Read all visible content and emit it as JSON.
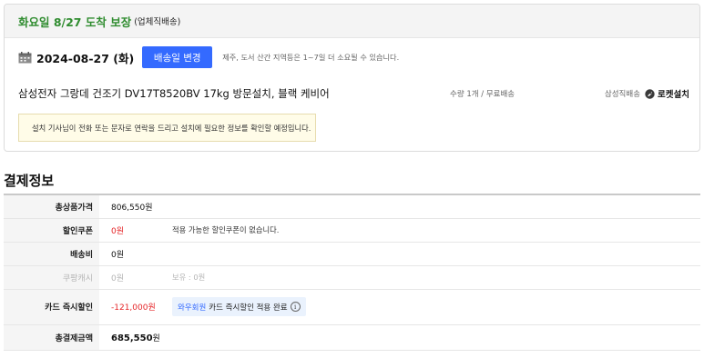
{
  "delivery": {
    "arrival_text": "화요일 8/27 도착 보장",
    "arrival_sub": "(업체직배송)",
    "date_text": "2024-08-27 (화)",
    "change_button": "배송일 변경",
    "date_note": "제주, 도서 산간 지역등은 1~7일 더 소요될 수 있습니다.",
    "product_name": "삼성전자 그랑데 건조기 DV17T8520BV 17kg 방문설치, 블랙 케비어",
    "quantity_text": "수량 1개 / 무료배송",
    "seller_label": "삼성직배송",
    "rocket_label": "로켓설치",
    "install_note": "설치 기사님이 전화 또는 문자로 연락을 드리고 설치에 필요한 정보를 확인할 예정입니다.",
    "accent_color": "#2f8c2f",
    "button_color": "#346aff"
  },
  "payment": {
    "title": "결제정보",
    "rows": [
      {
        "label": "총상품가격",
        "value": "806,550원",
        "info": ""
      },
      {
        "label": "할인쿠폰",
        "value": "0원",
        "info": "적용 가능한 할인쿠폰이 없습니다."
      },
      {
        "label": "배송비",
        "value": "0원",
        "info": ""
      },
      {
        "label": "쿠팡캐시",
        "value": "0원",
        "info": "보유 : 0원"
      },
      {
        "label": "카드 즉시할인",
        "value": "-121,000원",
        "info_link": "와우회원",
        "info_text": "카드 즉시할인 적용 완료",
        "info_icon": "i"
      },
      {
        "label": "총결제금액",
        "value_number": "685,550",
        "value_unit": "원"
      }
    ],
    "discount_color": "#e52528"
  }
}
